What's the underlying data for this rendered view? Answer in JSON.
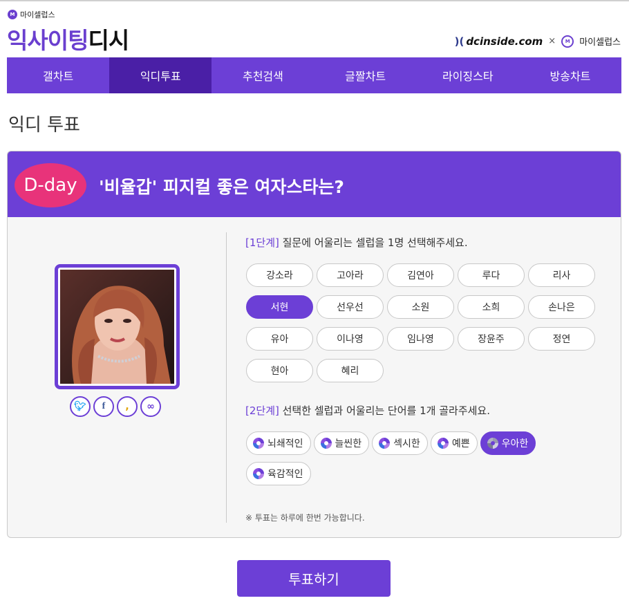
{
  "header": {
    "brand_small": "마이셀럽스",
    "brand_big_purple": "익사이팅",
    "brand_big_black": "디시",
    "partner_dc": "dcinside.com",
    "partner_cross": "×",
    "partner_name": "마이셀럽스"
  },
  "nav": {
    "items": [
      {
        "label": "갤차트"
      },
      {
        "label": "익디투표"
      },
      {
        "label": "추천검색"
      },
      {
        "label": "글짤차트"
      },
      {
        "label": "라이징스타"
      },
      {
        "label": "방송차트"
      }
    ],
    "active_index": 1
  },
  "page_title": "익디 투표",
  "vote": {
    "dday": "D-day",
    "question": "'비율갑' 피지컬 좋은 여자스타는?",
    "step1_tag": "[1단계]",
    "step1_text": " 질문에 어울리는 셀럽을 1명 선택해주세요.",
    "celebs": [
      "강소라",
      "고아라",
      "김연아",
      "루다",
      "리사",
      "서현",
      "선우선",
      "소원",
      "소희",
      "손나은",
      "유아",
      "이나영",
      "임나영",
      "장윤주",
      "정연",
      "현아",
      "혜리"
    ],
    "selected_celeb": "서현",
    "step2_tag": "[2단계]",
    "step2_text": " 선택한 셀럽과 어울리는 단어를 1개 골라주세요.",
    "words": [
      "뇌쇄적인",
      "늘씬한",
      "섹시한",
      "예쁜",
      "우아한",
      "육감적인"
    ],
    "selected_word": "우아한",
    "note": "※ 투표는 하루에 한번 가능합니다."
  },
  "share": [
    "twitter-icon",
    "facebook-icon",
    "kakao-icon",
    "link-icon"
  ],
  "vote_button": "투표하기",
  "colors": {
    "accent": "#6c3fd6",
    "accent_dark": "#4a1fa6",
    "dday": "#e8337a"
  }
}
